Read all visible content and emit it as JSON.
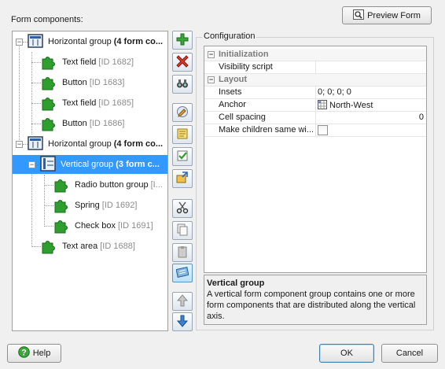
{
  "dialog": {
    "components_label": "Form components:",
    "preview_button": "Preview Form",
    "help_button": "Help",
    "ok_button": "OK",
    "cancel_button": "Cancel"
  },
  "tree": {
    "items": [
      {
        "name": "Horizontal group",
        "bold": "(4 form co...",
        "id": ""
      },
      {
        "name": "Text field",
        "bold": "",
        "id": "[ID 1682]"
      },
      {
        "name": "Button",
        "bold": "",
        "id": "[ID 1683]"
      },
      {
        "name": "Text field",
        "bold": "",
        "id": "[ID 1685]"
      },
      {
        "name": "Button",
        "bold": "",
        "id": "[ID 1686]"
      },
      {
        "name": "Horizontal group",
        "bold": "(4 form co...",
        "id": ""
      },
      {
        "name": "Vertical group",
        "bold": "(3 form c...",
        "id": ""
      },
      {
        "name": "Radio button group",
        "bold": "",
        "id": "[I..."
      },
      {
        "name": "Spring",
        "bold": "",
        "id": "[ID 1692]"
      },
      {
        "name": "Check box",
        "bold": "",
        "id": "[ID 1691]"
      },
      {
        "name": "Text area",
        "bold": "",
        "id": "[ID 1688]"
      }
    ]
  },
  "toolbar": {
    "icons": [
      "add-icon",
      "delete-icon",
      "find-icon",
      "edit-icon",
      "script-icon",
      "validate-icon",
      "transform-icon",
      "cut-icon",
      "copy-icon",
      "paste-icon",
      "properties-icon",
      "move-up-icon",
      "move-down-icon"
    ]
  },
  "config": {
    "title": "Configuration",
    "cat_initialization": "Initialization",
    "cat_layout": "Layout",
    "rows": [
      {
        "name": "Visibility script",
        "value": ""
      },
      {
        "name": "Insets",
        "value": "0; 0; 0; 0"
      },
      {
        "name": "Anchor",
        "value": "North-West"
      },
      {
        "name": "Cell spacing",
        "value": "0"
      },
      {
        "name": "Make children same wi...",
        "value": ""
      }
    ]
  },
  "description": {
    "title": "Vertical group",
    "text": "A vertical form component group contains one or more form components that are distributed along the vertical axis."
  },
  "colors": {
    "selection": "#3399ff",
    "puzzle_green": "#2e9e2e"
  }
}
